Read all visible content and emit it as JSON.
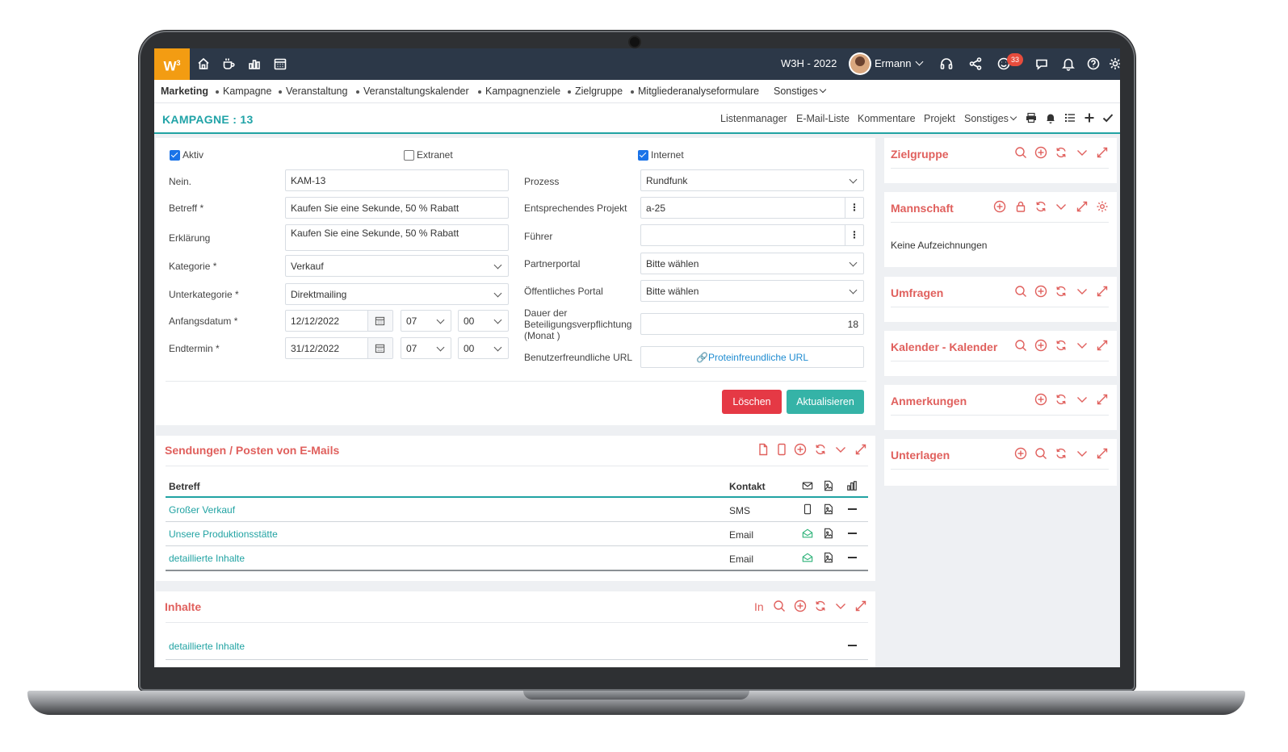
{
  "topbar": {
    "logo": "W",
    "logo_sup": "3",
    "workspace": "W3H - 2022",
    "user": "Ermann",
    "notification_count": "33"
  },
  "nav": {
    "items": [
      "Marketing",
      "Kampagne",
      "Veranstaltung",
      "Veranstaltungskalender",
      "Kampagnenziele",
      "Zielgruppe",
      "Mitgliederanalyseformulare",
      "Sonstiges"
    ]
  },
  "titlebar": {
    "title": "KAMPAGNE : 13",
    "links": [
      "Listenmanager",
      "E-Mail-Liste",
      "Kommentare",
      "Projekt",
      "Sonstiges"
    ]
  },
  "form": {
    "aktiv_label": "Aktiv",
    "extranet_label": "Extranet",
    "internet_label": "Internet",
    "nein_label": "Nein.",
    "nein_value": "KAM-13",
    "betreff_label": "Betreff *",
    "betreff_value": "Kaufen Sie eine Sekunde, 50 % Rabatt",
    "erklaerung_label": "Erklärung",
    "erklaerung_value": "Kaufen Sie eine Sekunde, 50 % Rabatt",
    "kategorie_label": "Kategorie *",
    "kategorie_value": "Verkauf",
    "unterkategorie_label": "Unterkategorie *",
    "unterkategorie_value": "Direktmailing",
    "anfangsdatum_label": "Anfangsdatum *",
    "anfangsdatum_value": "12/12/2022",
    "anfang_hour": "07",
    "anfang_min": "00",
    "endtermin_label": "Endtermin *",
    "endtermin_value": "31/12/2022",
    "end_hour": "07",
    "end_min": "00",
    "prozess_label": "Prozess",
    "prozess_value": "Rundfunk",
    "projekt_label": "Entsprechendes Projekt",
    "projekt_value": "a-25",
    "fuehrer_label": "Führer",
    "fuehrer_value": "",
    "partnerportal_label": "Partnerportal",
    "partnerportal_value": "Bitte wählen",
    "oeffentlich_label": "Öffentliches Portal",
    "oeffentlich_value": "Bitte wählen",
    "dauer_label_1": "Dauer der",
    "dauer_label_2": "Beteiligungsverpflichtung",
    "dauer_label_3": "(Monat )",
    "dauer_value": "18",
    "url_label": "Benutzerfreundliche URL",
    "url_value": "Proteinfreundliche URL",
    "delete_label": "Löschen",
    "update_label": "Aktualisieren"
  },
  "mailings": {
    "title": "Sendungen / Posten von E-Mails",
    "col_subject": "Betreff",
    "col_contact": "Kontakt",
    "rows": [
      {
        "subject": "Großer Verkauf",
        "contact": "SMS"
      },
      {
        "subject": "Unsere Produktionsstätte",
        "contact": "Email"
      },
      {
        "subject": "detaillierte Inhalte",
        "contact": "Email"
      }
    ]
  },
  "contents": {
    "title": "Inhalte",
    "prefix": "In",
    "rows": [
      {
        "subject": "detaillierte Inhalte"
      }
    ]
  },
  "sidebar": {
    "zielgruppe": "Zielgruppe",
    "mannschaft": "Mannschaft",
    "mannschaft_empty": "Keine Aufzeichnungen",
    "umfragen": "Umfragen",
    "kalender": "Kalender - Kalender",
    "anmerkungen": "Anmerkungen",
    "unterlagen": "Unterlagen"
  },
  "colors": {
    "accent": "#20a3a7",
    "section": "#e0605d",
    "danger": "#e53945",
    "topbar": "#2c3848",
    "logo": "#f39c12"
  }
}
